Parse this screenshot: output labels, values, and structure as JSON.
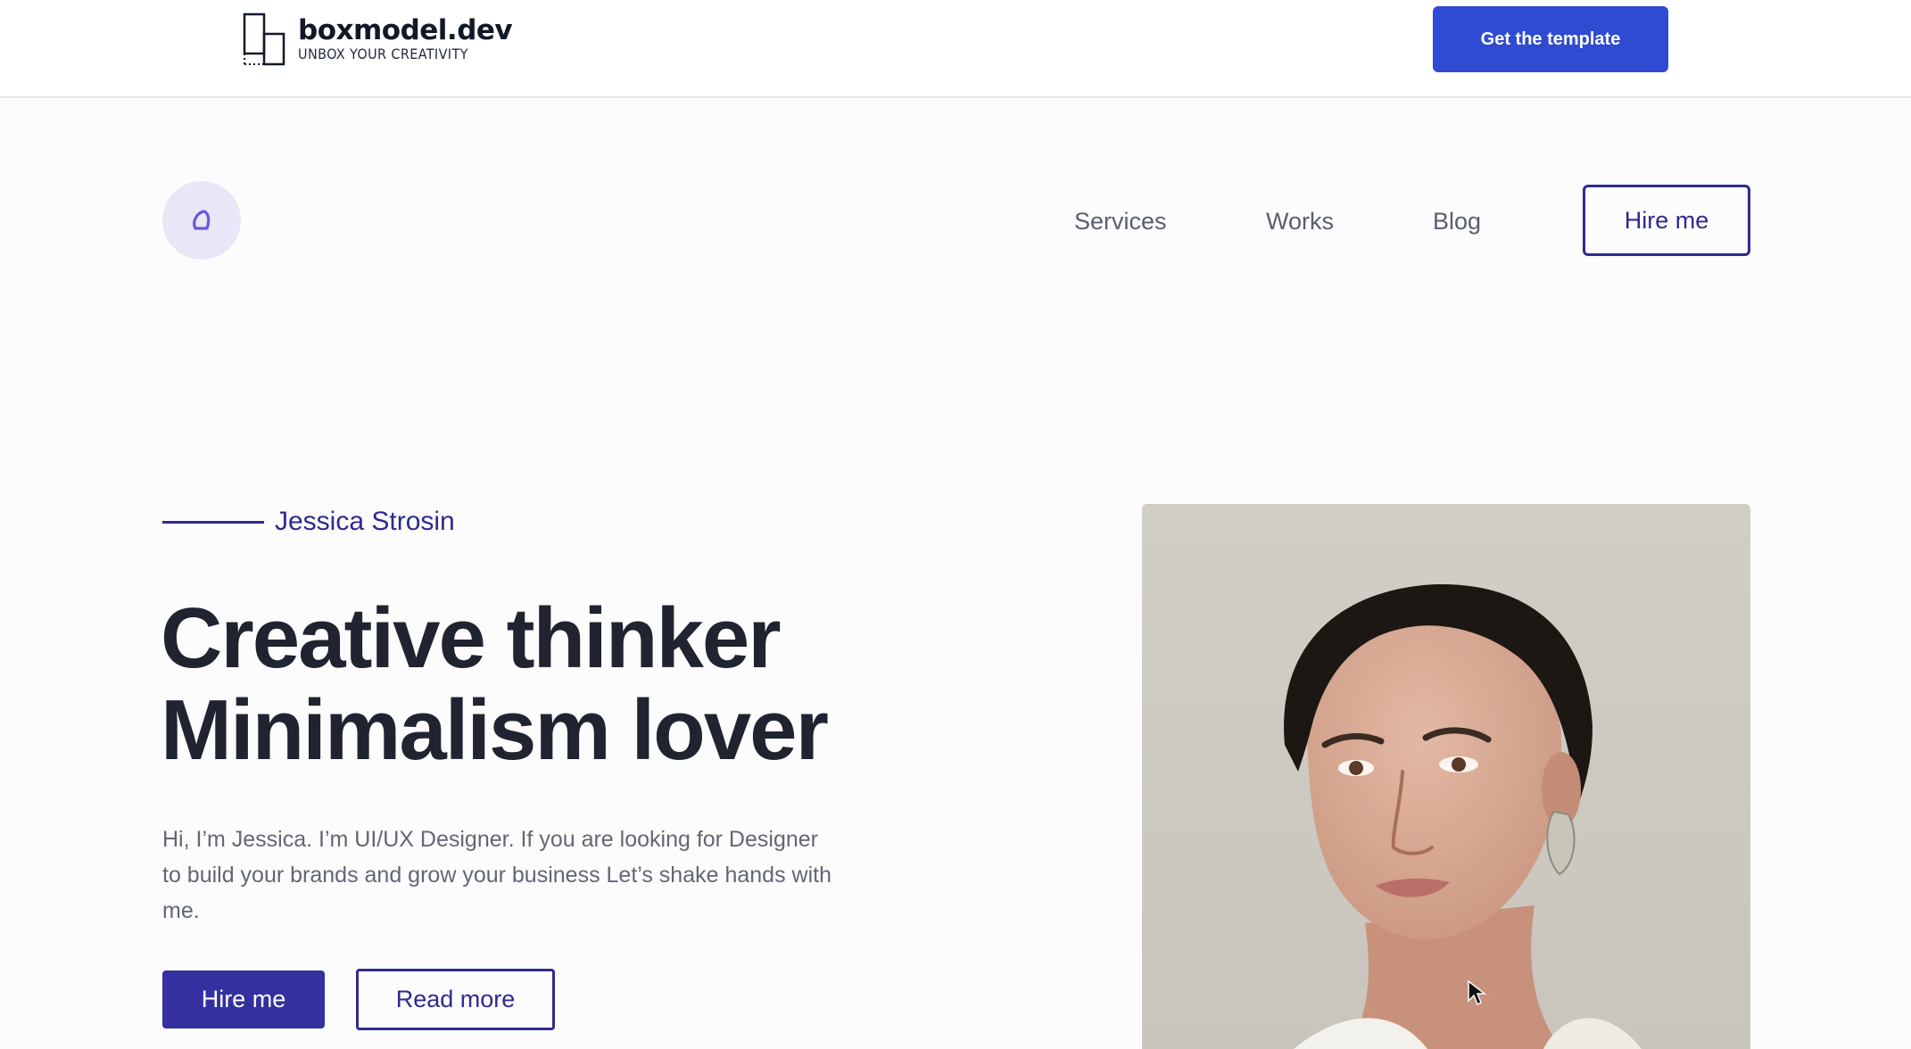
{
  "topbar": {
    "brand_name": "boxmodel.dev",
    "brand_tagline": "UNBOX YOUR CREATIVITY",
    "cta_label": "Get the template"
  },
  "nav": {
    "links": [
      "Services",
      "Works",
      "Blog"
    ],
    "hire_label": "Hire me"
  },
  "hero": {
    "eyebrow": "Jessica Strosin",
    "headline_line1": "Creative thinker",
    "headline_line2": "Minimalism lover",
    "intro": "Hi, I’m Jessica. I’m UI/UX Designer. If you are looking for Designer to build your brands and grow your business Let’s shake hands with me.",
    "primary_button": "Hire me",
    "secondary_button": "Read more"
  },
  "colors": {
    "accent": "#2e2a8f",
    "cta_blue": "#2f4bd1",
    "heading": "#1f2430",
    "body_text": "#626774",
    "logo_bg": "#e9e6f8"
  },
  "icons": {
    "brand_mark": "box-outline-icon",
    "site_logo": "leaf-d-icon",
    "cursor": "mouse-pointer-icon"
  }
}
